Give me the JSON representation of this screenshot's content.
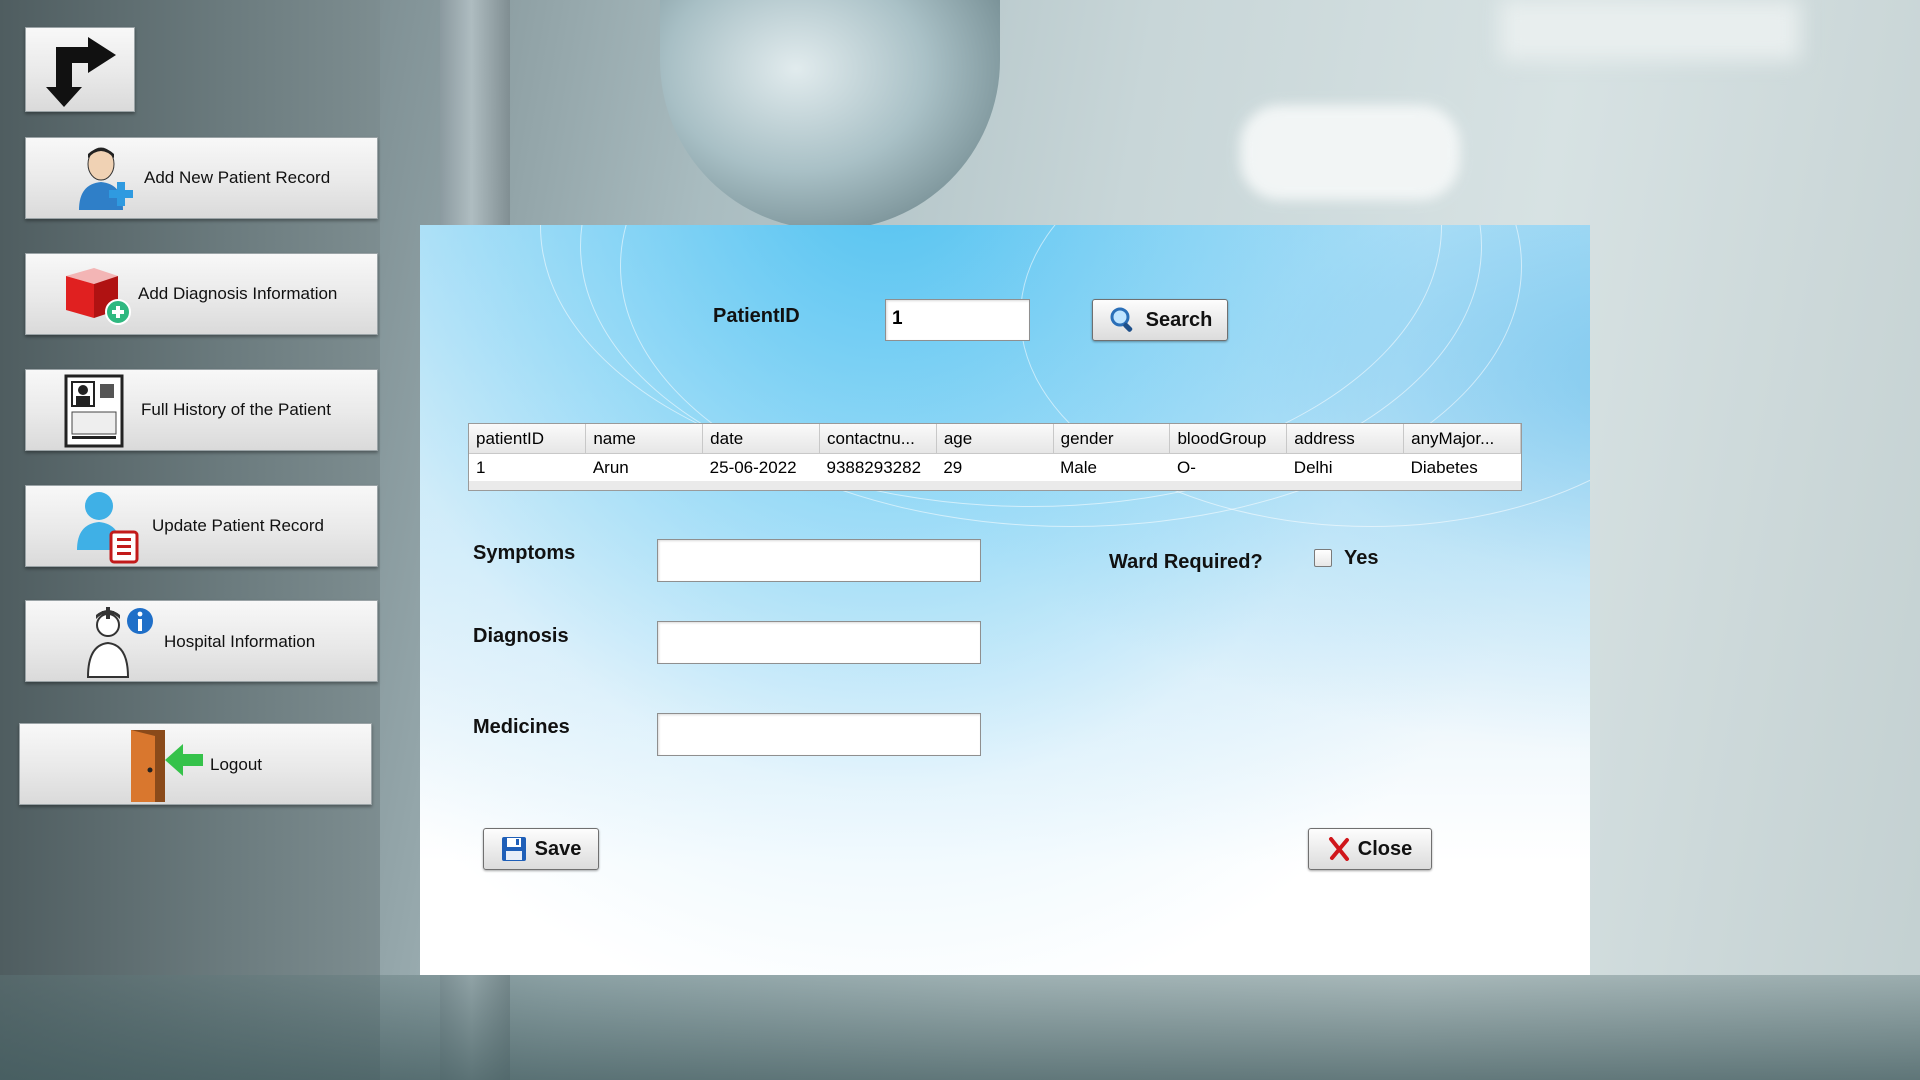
{
  "sidebar": {
    "items": [
      {
        "label": "Add New Patient Record",
        "icon": "add-patient-icon"
      },
      {
        "label": "Add Diagnosis Information",
        "icon": "add-diagnosis-icon"
      },
      {
        "label": "Full History of the Patient",
        "icon": "patient-history-icon"
      },
      {
        "label": "Update Patient Record",
        "icon": "update-record-icon"
      },
      {
        "label": "Hospital Information",
        "icon": "hospital-info-icon"
      },
      {
        "label": "Logout",
        "icon": "logout-door-icon"
      }
    ],
    "top_icon": "swap-arrows-icon"
  },
  "search": {
    "label": "PatientID",
    "value": "1",
    "button_label": "Search"
  },
  "table": {
    "columns": [
      "patientID",
      "name",
      "date",
      "contactnu...",
      "age",
      "gender",
      "bloodGroup",
      "address",
      "anyMajor..."
    ],
    "rows": [
      [
        "1",
        "Arun",
        "25-06-2022",
        "9388293282",
        "29",
        "Male",
        "O-",
        "Delhi",
        "Diabetes"
      ]
    ]
  },
  "form": {
    "symptoms_label": "Symptoms",
    "symptoms_value": "",
    "diagnosis_label": "Diagnosis",
    "diagnosis_value": "",
    "medicines_label": "Medicines",
    "medicines_value": "",
    "ward_label": "Ward Required?",
    "ward_option_label": "Yes",
    "ward_checked": false
  },
  "actions": {
    "save_label": "Save",
    "close_label": "Close"
  },
  "colors": {
    "panel_accent": "#4cc3ee",
    "close_x": "#d0161b",
    "save_disk": "#1f5fb8"
  }
}
